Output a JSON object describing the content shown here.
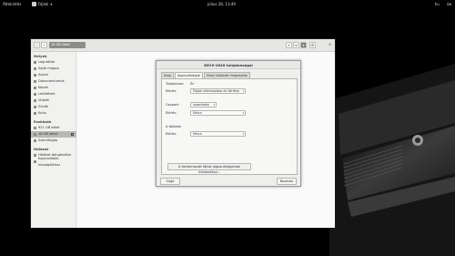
{
  "topbar": {
    "activities": "Áttekintés",
    "app_name": "Fájlok",
    "clock": "július 28, 13:49",
    "language": "hu"
  },
  "file_manager": {
    "path_label": "16 GB kötet",
    "sidebar": {
      "section_places": "Helyek",
      "places": [
        "Legutóbbi",
        "Saját mappa",
        "Asztal",
        "Dokumentumok",
        "Képek",
        "Letöltések",
        "Videók",
        "Zenék",
        "Kuka"
      ],
      "section_devices": "Eszközök",
      "devices": [
        "921 GB kötet",
        "16 GB kötet",
        "Számítógép"
      ],
      "section_network": "Hálózat",
      "network": [
        "Hálózat böngészése",
        "Kapcsolódás kiszolgálóhoz"
      ]
    }
  },
  "dialog": {
    "title": "DE19-1645 tulajdonságai",
    "tabs": [
      "Alap",
      "Jogosultságok",
      "Helyi hálózati megosztás"
    ],
    "owner_label": "Tulajdonos:",
    "owner_value": "Én",
    "access_label_1": "Elérés:",
    "access_value_1": "Fájlok létrehozása és törlése",
    "group_label": "Csoport:",
    "group_value": "zsomitotp",
    "access_label_2": "Elérés:",
    "access_value_2": "Nincs",
    "others_label": "A többiek",
    "access_label_3": "Elérés:",
    "access_value_3": "Nincs",
    "restore_button": "A tartalmazott fájlok jogosultságainak módosítása...",
    "help_button": "Súgó",
    "close_button": "Bezárás"
  },
  "icons": {
    "back": "chevron-left-icon",
    "forward": "chevron-right-icon",
    "search": "search-icon",
    "view": "list-view-icon",
    "menu": "menu-icon",
    "close": "close-icon"
  }
}
